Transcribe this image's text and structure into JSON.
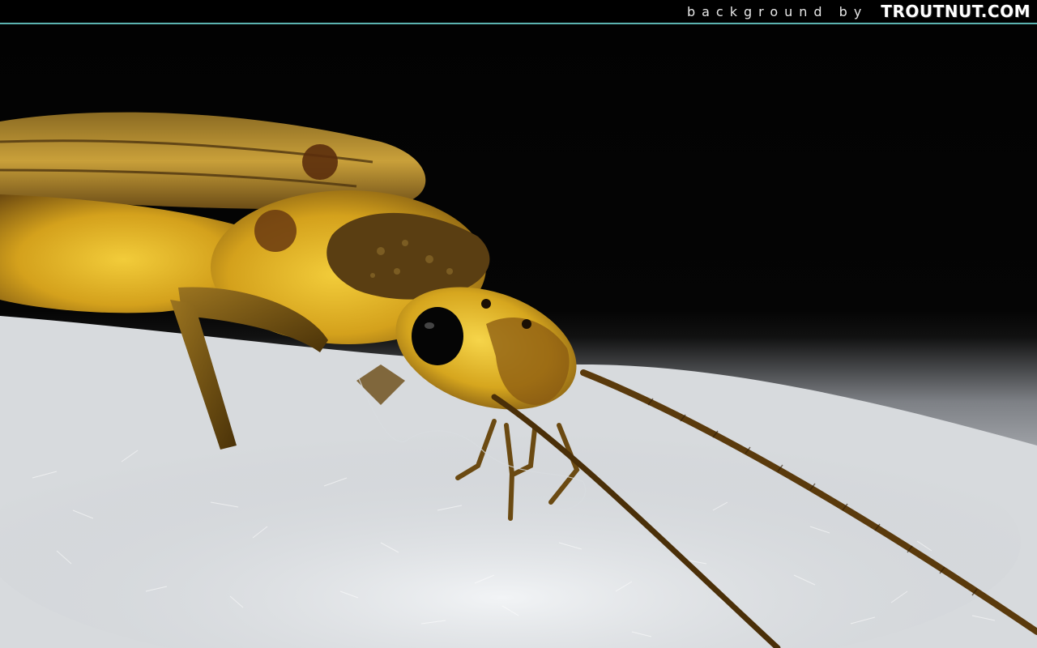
{
  "header": {
    "credit_text": "background by",
    "logo_text": "TROUTNUT.COM"
  },
  "scene": {
    "subject": "stonefly-photo",
    "colors": {
      "body_yellow": "#d9a81c",
      "body_dark": "#6b4a12",
      "eye": "#050505",
      "snow": "#e4e7ea",
      "background": "#000000",
      "accent_line": "#5bb3b0"
    }
  }
}
